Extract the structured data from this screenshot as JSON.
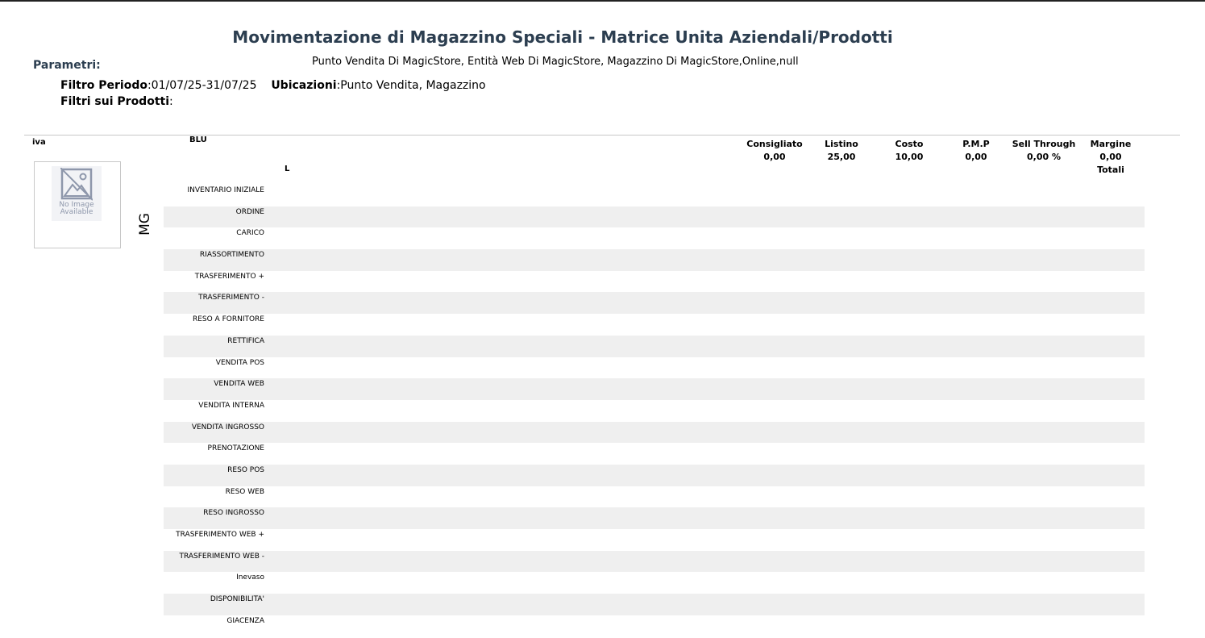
{
  "report": {
    "title": "Movimentazione di Magazzino Speciali - Matrice Unita Aziendali/Prodotti",
    "params_label": "Parametri:",
    "business_units": "Punto Vendita Di MagicStore, Entità Web Di MagicStore, Magazzino Di MagicStore,Online,null",
    "period_label": "Filtro Periodo",
    "period_value": ":01/07/25-31/07/25",
    "locations_label": "Ubicazioni",
    "locations_value": ":Punto Vendita, Magazzino",
    "product_filters_label": "Filtri sui Prodotti",
    "product_filters_value": ":"
  },
  "product": {
    "code": "iva",
    "color": "BLU",
    "size": "L",
    "location_code": "MG",
    "image_text_1": "No Image",
    "image_text_2": "Available",
    "image_icon": "no-image-icon"
  },
  "price_columns": [
    {
      "header": "Consigliato",
      "value": "0,00",
      "extra": ""
    },
    {
      "header": "Listino",
      "value": "25,00",
      "extra": ""
    },
    {
      "header": "Costo",
      "value": "10,00",
      "extra": ""
    },
    {
      "header": "P.M.P",
      "value": "0,00",
      "extra": ""
    },
    {
      "header": "Sell Through",
      "value": "0,00 %",
      "extra": ""
    },
    {
      "header": "Margine",
      "value": "0,00",
      "extra": "Totali"
    }
  ],
  "movement_rows": [
    "INVENTARIO INIZIALE",
    "ORDINE",
    "CARICO",
    "RIASSORTIMENTO",
    "TRASFERIMENTO +",
    "TRASFERIMENTO -",
    "RESO A FORNITORE",
    "RETTIFICA",
    "VENDITA POS",
    "VENDITA WEB",
    "VENDITA INTERNA",
    "VENDITA INGROSSO",
    "PRENOTAZIONE",
    "RESO POS",
    "RESO WEB",
    "RESO INGROSSO",
    "TRASFERIMENTO WEB +",
    "TRASFERIMENTO WEB -",
    "Inevaso",
    "DISPONIBILITA'",
    "GIACENZA"
  ]
}
